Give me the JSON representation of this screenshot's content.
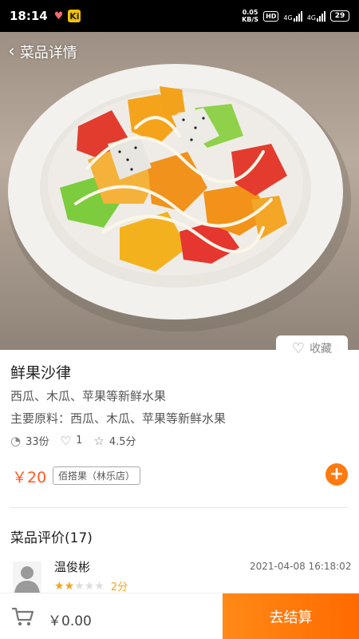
{
  "status": {
    "time": "18:14",
    "badge": "Ki",
    "net_speed": "0.05",
    "net_unit": "KB/S",
    "hd": "HD",
    "sig1": "4G",
    "sig2": "4G",
    "battery": "29"
  },
  "header": {
    "back_label": "菜品详情"
  },
  "favorite": {
    "label": "收藏"
  },
  "dish": {
    "name": "鲜果沙律",
    "desc": "西瓜、木瓜、苹果等新鲜水果",
    "ingredients": "主要原料：西瓜、木瓜、苹果等新鲜水果",
    "stats": {
      "sales": "33份",
      "likes": "1",
      "rating": "4.5分"
    },
    "price": "￥20",
    "shop": "佰搭果（林乐店）"
  },
  "reviews": {
    "title": "菜品评价(17)",
    "items": [
      {
        "name": "温俊彬",
        "date": "2021-04-08 16:18:02",
        "stars": 2,
        "score": "2分"
      }
    ]
  },
  "cart": {
    "total": "￥0.00",
    "checkout_label": "去结算"
  },
  "colors": {
    "accent": "#ff6a00",
    "price": "#ff5a1f",
    "star": "#f6a21a"
  }
}
